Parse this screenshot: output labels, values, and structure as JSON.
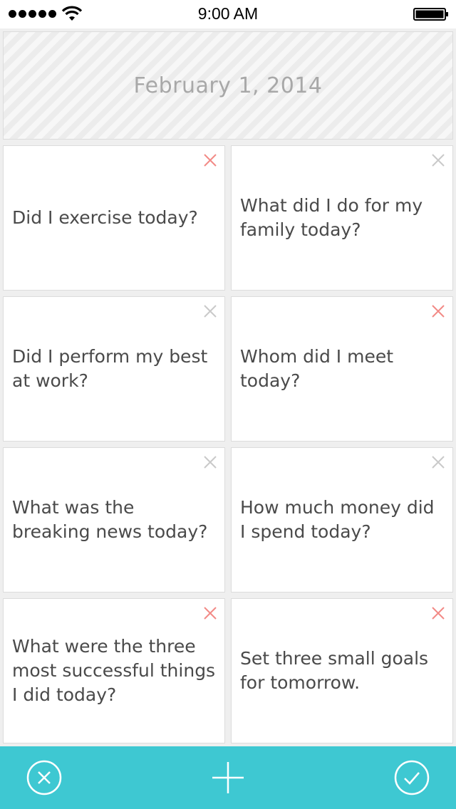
{
  "status_bar": {
    "time": "9:00 AM"
  },
  "header": {
    "date": "February 1, 2014"
  },
  "cards": [
    {
      "text": "Did I exercise today?",
      "remove_active": true
    },
    {
      "text": "What did I do for my family today?",
      "remove_active": false
    },
    {
      "text": "Did I perform my best at work?",
      "remove_active": false
    },
    {
      "text": "Whom did I meet today?",
      "remove_active": true
    },
    {
      "text": "What was the breaking news today?",
      "remove_active": false
    },
    {
      "text": "How much money did I spend today?",
      "remove_active": false
    },
    {
      "text": "What were the three most successful things I did today?",
      "remove_active": true
    },
    {
      "text": "Set three small goals for tomorrow.",
      "remove_active": true
    }
  ],
  "toolbar": {
    "cancel_icon": "circle-x-icon",
    "add_icon": "plus-icon",
    "confirm_icon": "circle-check-icon"
  },
  "colors": {
    "accent": "#3ec8d2",
    "remove_active": "#f28a86",
    "remove_inactive": "#c9c9c9",
    "card_text": "#4a4a4a",
    "date_text": "#a8a8a8"
  }
}
